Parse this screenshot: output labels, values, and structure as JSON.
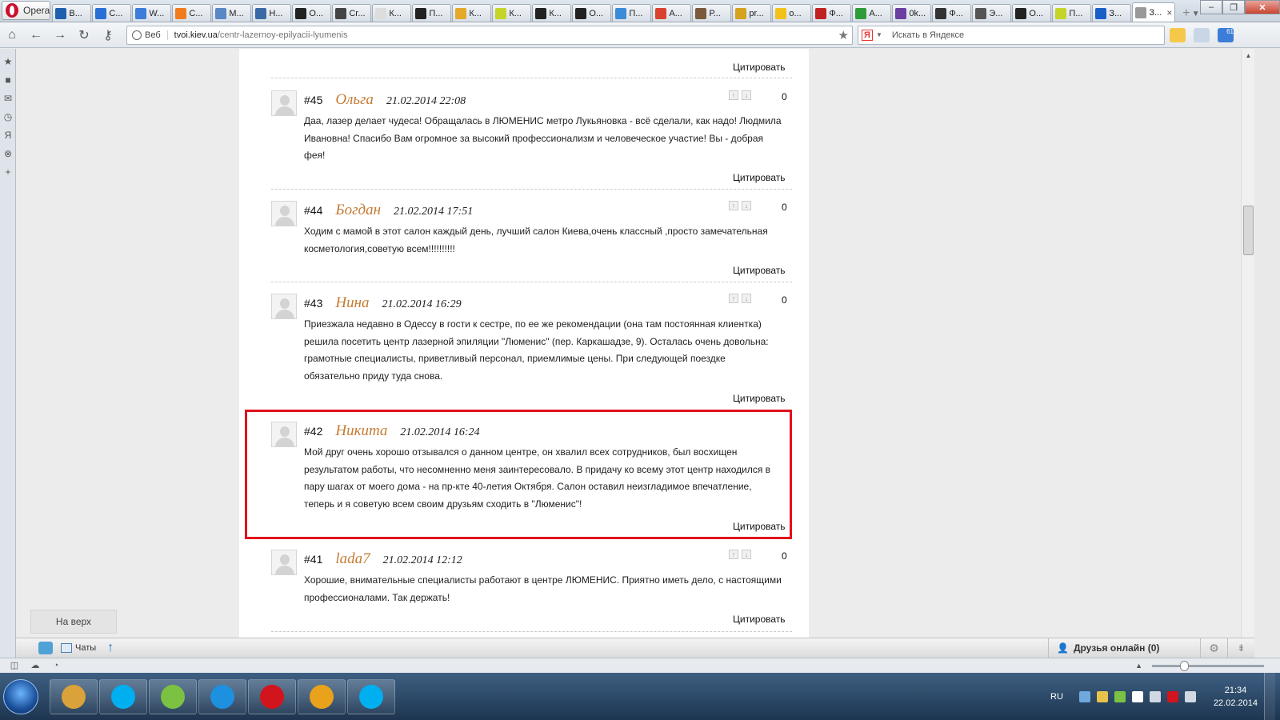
{
  "browser": {
    "menu_label": "Opera",
    "tabs": [
      {
        "label": "В...",
        "color": "#1f5fae"
      },
      {
        "label": "С...",
        "color": "#2a6fd6"
      },
      {
        "label": "W...",
        "color": "#3b7dd8"
      },
      {
        "label": "С...",
        "color": "#f07c1e"
      },
      {
        "label": "М...",
        "color": "#5a87c5"
      },
      {
        "label": "Н...",
        "color": "#3a6aa5"
      },
      {
        "label": "О...",
        "color": "#222222"
      },
      {
        "label": "Cr...",
        "color": "#444444"
      },
      {
        "label": "К...",
        "color": "#dddddd"
      },
      {
        "label": "П...",
        "color": "#222222"
      },
      {
        "label": "К...",
        "color": "#e3a92b"
      },
      {
        "label": "К...",
        "color": "#c6d428"
      },
      {
        "label": "К...",
        "color": "#222222"
      },
      {
        "label": "О...",
        "color": "#222222"
      },
      {
        "label": "П...",
        "color": "#3b8bd8"
      },
      {
        "label": "А...",
        "color": "#d8422e"
      },
      {
        "label": "Р...",
        "color": "#7a5a3a"
      },
      {
        "label": "pr...",
        "color": "#d4a21f"
      },
      {
        "label": "о...",
        "color": "#f2c21b"
      },
      {
        "label": "Ф...",
        "color": "#c02222"
      },
      {
        "label": "А...",
        "color": "#2f9c3a"
      },
      {
        "label": "0k...",
        "color": "#6a3fa0"
      },
      {
        "label": "Ф...",
        "color": "#333333"
      },
      {
        "label": "Э...",
        "color": "#555555"
      },
      {
        "label": "О...",
        "color": "#222222"
      },
      {
        "label": "П...",
        "color": "#c6d428"
      },
      {
        "label": "З...",
        "color": "#1a5fc8"
      },
      {
        "label": "З...",
        "color": "#999999"
      }
    ],
    "address": {
      "mode_label": "Веб",
      "host": "tvoi.kiev.ua",
      "path": "/centr-lazernoy-epilyacii-lyumenis"
    },
    "search": {
      "engine_letter": "Я",
      "placeholder": "Искать в Яндексе"
    },
    "mail_count": "61"
  },
  "page": {
    "quote_label": "Цитировать",
    "to_top_label": "На верх",
    "comments": [
      {
        "number": "#45",
        "author": "Ольга",
        "date": "21.02.2014 22:08",
        "score": "0",
        "has_votes": true,
        "text": "Даа, лазер делает чудеса! Обращалась в ЛЮМЕНИС метро Лукьяновка - всё сделали, как надо! Людмила Ивановна! Спасибо Вам огромное за высокий профессионализм и человеческое участие! Вы - добрая фея!"
      },
      {
        "number": "#44",
        "author": "Богдан",
        "date": "21.02.2014 17:51",
        "score": "0",
        "has_votes": true,
        "text": "Ходим с мамой в этот салон каждый день, лучший салон Киева,очень классный ,просто замечательная косметология,советую всем!!!!!!!!!!"
      },
      {
        "number": "#43",
        "author": "Нина",
        "date": "21.02.2014 16:29",
        "score": "0",
        "has_votes": true,
        "text": "Приезжала недавно в Одессу в гости к сестре, по ее же рекомендации (она там постоянная клиентка) решила посетить центр лазерной эпиляции \"Люменис\" (пер. Каркашадзе, 9). Осталась очень довольна: грамотные специалисты, приветливый персонал, приемлимые цены. При следующей поездке обязательно приду туда снова."
      },
      {
        "number": "#42",
        "author": "Никита",
        "date": "21.02.2014 16:24",
        "score": "",
        "has_votes": false,
        "text": "Мой друг очень хорошо отзывался о данном центре, он хвалил всех сотрудников, был восхищен результатом работы, что несомненно меня заинтересовало. В придачу ко всему этот центр находился в пару шагах от моего дома - на пр-кте 40-летия Октября. Салон оставил неизгладимое впечатление, теперь и я советую всем своим друзьям сходить в \"Люменис\"!"
      },
      {
        "number": "#41",
        "author": "lada7",
        "date": "21.02.2014 12:12",
        "score": "0",
        "has_votes": true,
        "text": "Хорошие, внимательные специалисты работают в центре ЛЮМЕНИС. Приятно иметь дело, с настоящими профессионалами. Так держать!"
      }
    ]
  },
  "social_bar": {
    "chats_label": "Чаты",
    "friends_label": "Друзья онлайн (0)"
  },
  "taskbar": {
    "lang": "RU",
    "time": "21:34",
    "date": "22.02.2014",
    "apps": [
      {
        "name": "paint",
        "color": "#d9a23a"
      },
      {
        "name": "skype",
        "color": "#00aff0"
      },
      {
        "name": "game",
        "color": "#7cc242"
      },
      {
        "name": "internet-explorer",
        "color": "#1e90e0"
      },
      {
        "name": "opera",
        "color": "#d2141c"
      },
      {
        "name": "chrome",
        "color": "#e8a21b"
      },
      {
        "name": "skype",
        "color": "#00aff0"
      }
    ]
  }
}
